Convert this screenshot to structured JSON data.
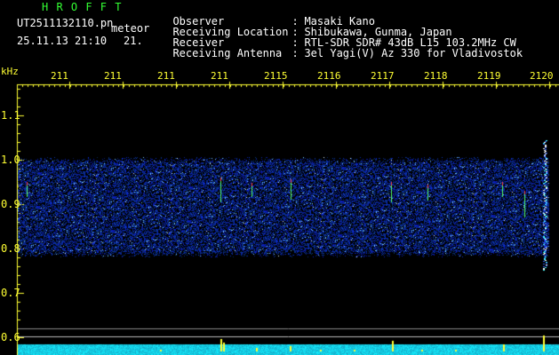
{
  "header": {
    "app_name": "H R O F F T",
    "filename": "UT2511132110.pn",
    "tag": "meteor",
    "datetime": "25.11.13 21:10",
    "frame": "21.",
    "info": [
      {
        "label": "Observer",
        "sep": ":",
        "value": "Masaki Kano"
      },
      {
        "label": "Receiving Location",
        "sep": ":",
        "value": "Shibukawa, Gunma, Japan"
      },
      {
        "label": "Receiver",
        "sep": ":",
        "value": "RTL-SDR SDR# 43dB L15 103.2MHz CW"
      },
      {
        "label": "Receiving Antenna",
        "sep": ":",
        "value": "3el Yagi(V) Az 330 for Vladivostok"
      }
    ]
  },
  "axis": {
    "unit": "kHz",
    "y_ticks": [
      "1.1",
      "1.0",
      "0.9",
      "0.8",
      "0.7",
      "0.6"
    ],
    "x_ticks": [
      "211",
      "211",
      "211",
      "211",
      "2115",
      "2116",
      "2117",
      "2118",
      "2119",
      "2120"
    ]
  },
  "colors": {
    "text": "#ffff33",
    "title": "#33ff33",
    "info": "#ffffff",
    "signal": "#2233cc",
    "baseline": "#33ddff"
  }
}
